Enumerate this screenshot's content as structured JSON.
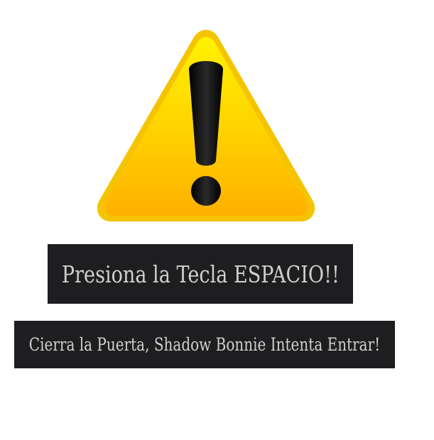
{
  "warning": {
    "icon": "warning-exclamation-icon",
    "colors": {
      "fill_top": "#ffe600",
      "fill_bottom": "#ffb300",
      "border": "#f7c600",
      "mark": "#111111"
    }
  },
  "messages": {
    "primary": "Presiona la Tecla ESPACIO!!",
    "secondary": "Cierra la Puerta, Shadow Bonnie Intenta Entrar!"
  },
  "colors": {
    "banner_bg": "#1e1e20",
    "banner_text": "#cfcfcf"
  }
}
